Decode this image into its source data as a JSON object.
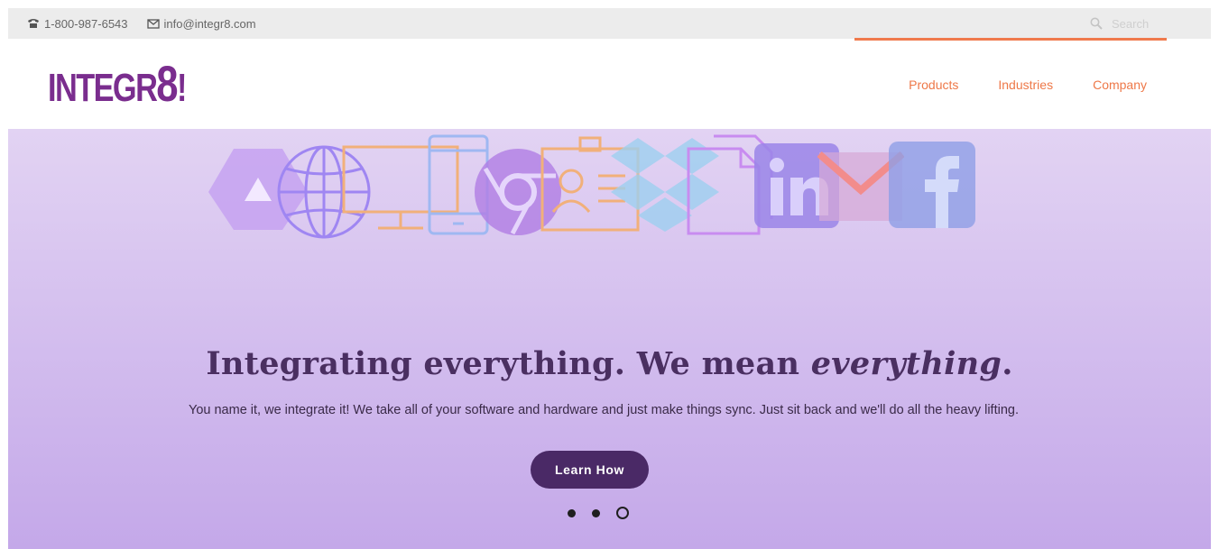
{
  "topbar": {
    "phone": "1-800-987-6543",
    "email": "info@integr8.com",
    "search_placeholder": "Search"
  },
  "header": {
    "logo_prefix": "INTEGR",
    "logo_eight": "8",
    "logo_suffix": "!",
    "nav": [
      "Products",
      "Industries",
      "Company"
    ]
  },
  "hero": {
    "headline_plain": "Integrating everything. We mean ",
    "headline_italic": "everything",
    "headline_end": ".",
    "subtext": "You name it, we integrate it! We take all of your software and hardware and just make things sync. Just sit back and we'll do all the heavy lifting.",
    "cta": "Learn How",
    "icons": [
      "google-drive-icon",
      "globe-icon",
      "monitor-icon",
      "phone-icon",
      "chrome-icon",
      "contact-card-icon",
      "dropbox-icon",
      "document-icon",
      "linkedin-icon",
      "gmail-icon",
      "facebook-icon"
    ]
  },
  "carousel": {
    "slide_count": 3,
    "active_index": 2
  },
  "colors": {
    "brand_purple": "#7a2d8e",
    "nav_orange": "#ee7848",
    "cta_bg": "#4a2966",
    "hero_top": "#e2d3f3",
    "hero_bottom": "#c4a8e9"
  }
}
